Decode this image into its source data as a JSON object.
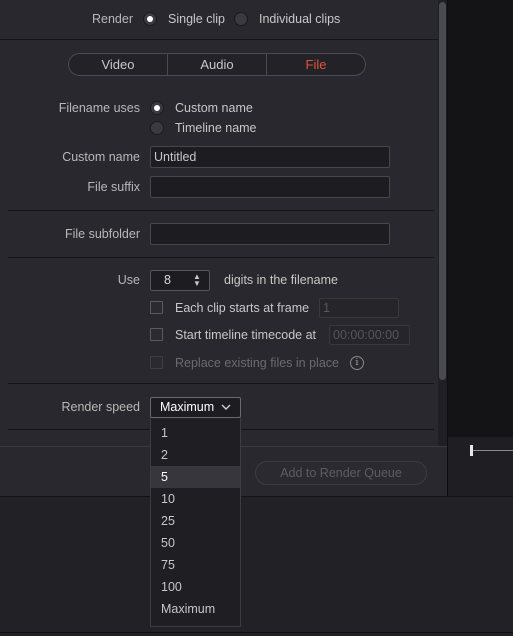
{
  "render": {
    "label": "Render",
    "options": [
      "Single clip",
      "Individual clips"
    ],
    "selected": "Single clip"
  },
  "tabs": [
    {
      "label": "Video",
      "active": false
    },
    {
      "label": "Audio",
      "active": false
    },
    {
      "label": "File",
      "active": true
    }
  ],
  "filename_uses": {
    "label": "Filename uses",
    "options": [
      "Custom name",
      "Timeline name"
    ],
    "selected": "Custom name"
  },
  "custom_name": {
    "label": "Custom name",
    "value": "Untitled"
  },
  "file_suffix": {
    "label": "File suffix",
    "value": ""
  },
  "file_subfolder": {
    "label": "File subfolder",
    "value": ""
  },
  "digits": {
    "label_before": "Use",
    "value": "8",
    "label_after": "digits in the filename"
  },
  "each_clip": {
    "label": "Each clip starts at frame",
    "checked": false,
    "value": "1"
  },
  "start_tc": {
    "label": "Start timeline timecode at",
    "checked": false,
    "value": "00:00:00:00"
  },
  "replace": {
    "label": "Replace existing files in place",
    "checked": false,
    "enabled": false
  },
  "render_speed": {
    "label": "Render speed",
    "value": "Maximum",
    "options": [
      "1",
      "2",
      "5",
      "10",
      "25",
      "50",
      "75",
      "100",
      "Maximum"
    ],
    "highlighted": "5"
  },
  "add_to_queue": {
    "label": "Add to Render Queue",
    "enabled": false
  },
  "colors": {
    "accent": "#e0533f",
    "background": "#28282e"
  }
}
